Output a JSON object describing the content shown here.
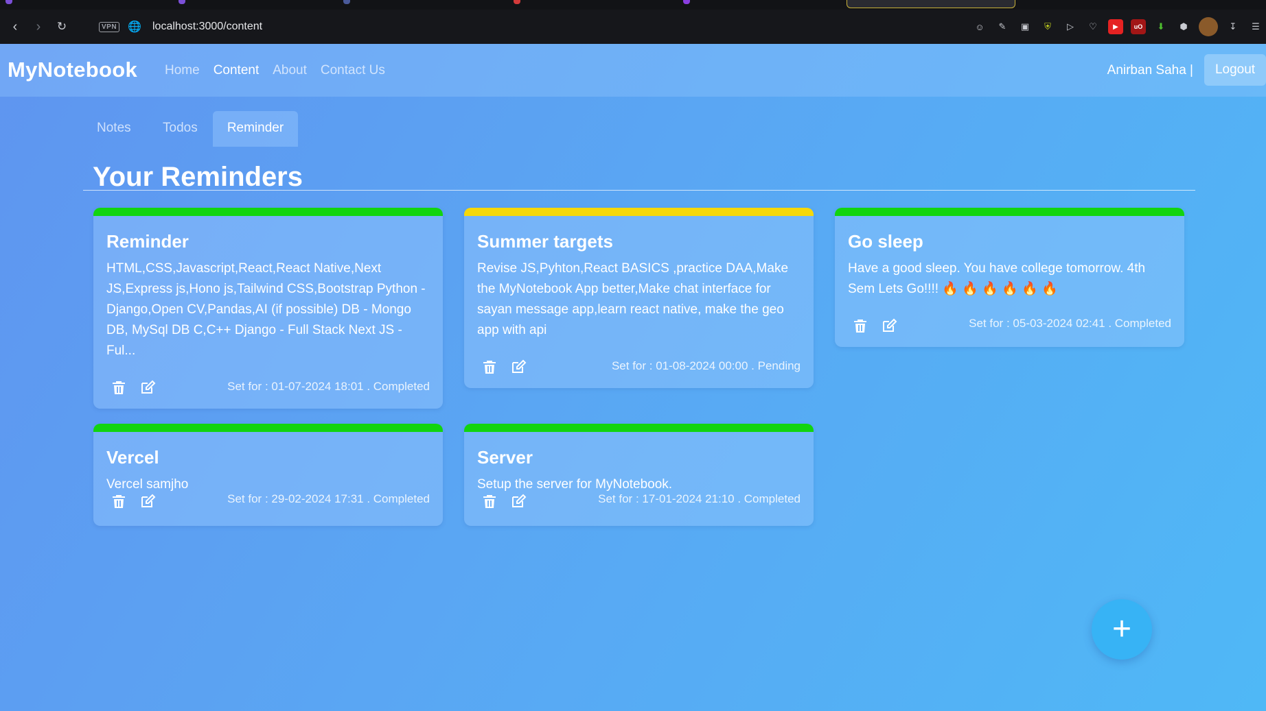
{
  "browser": {
    "url": "localhost:3000/content",
    "vpn_label": "VPN"
  },
  "app": {
    "brand": "MyNotebook",
    "nav": [
      "Home",
      "Content",
      "About",
      "Contact Us"
    ],
    "active_nav": "Content",
    "user": "Anirban Saha |",
    "logout": "Logout"
  },
  "tabs": [
    "Notes",
    "Todos",
    "Reminder"
  ],
  "active_tab": "Reminder",
  "title": "Your Reminders",
  "colors": {
    "completed": "#12d40f",
    "pending": "#f6d80a",
    "accent": "#37b3f5"
  },
  "reminders": [
    {
      "title": "Reminder",
      "body": "HTML,CSS,Javascript,React,React Native,Next JS,Express js,Hono js,Tailwind CSS,Bootstrap Python - Django,Open CV,Pandas,AI (if possible) DB - Mongo DB, MySql DB C,C++ Django - Full Stack Next JS - Ful...",
      "meta": "Set for : 01-07-2024 18:01 . Completed",
      "status": "completed"
    },
    {
      "title": "Summer targets",
      "body": "Revise JS,Pyhton,React BASICS ,practice DAA,Make the MyNotebook App better,Make chat interface for sayan message app,learn react native, make the geo app with api",
      "meta": "Set for : 01-08-2024 00:00 . Pending",
      "status": "pending"
    },
    {
      "title": "Go sleep",
      "body": "Have a good sleep. You have college tomorrow. 4th Sem Lets Go!!!! 🔥 🔥 🔥 🔥 🔥 🔥",
      "meta": "Set for : 05-03-2024 02:41 . Completed",
      "status": "completed"
    },
    {
      "title": "Vercel",
      "body": "Vercel samjho",
      "meta": "Set for : 29-02-2024 17:31 . Completed",
      "status": "completed"
    },
    {
      "title": "Server",
      "body": "Setup the server for MyNotebook.",
      "meta": "Set for : 17-01-2024 21:10 . Completed",
      "status": "completed"
    }
  ],
  "fab_label": "+"
}
